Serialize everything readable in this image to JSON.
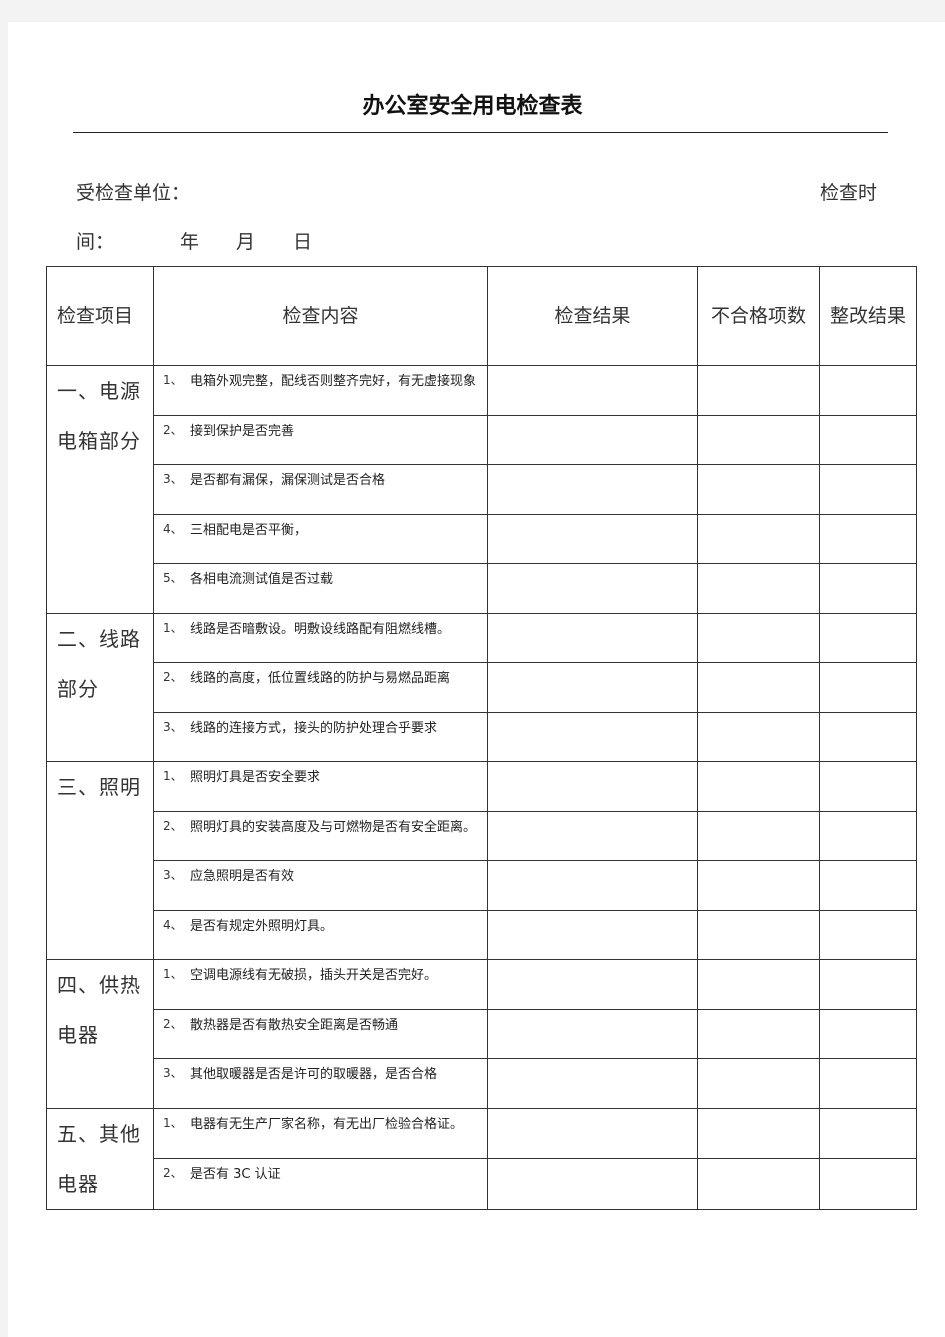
{
  "document": {
    "title": "办公室安全用电检查表",
    "unit_label": "受检查单位：",
    "time_label_part1": "检查时",
    "time_label_part2": "间：",
    "date_year": "年",
    "date_month": "月",
    "date_day": "日"
  },
  "table": {
    "headers": {
      "item": "检查项目",
      "content": "检查内容",
      "result": "检查结果",
      "fail_count": "不合格项数",
      "rectify": "整改结果"
    },
    "sections": [
      {
        "category": "一、电源电箱部分",
        "items": [
          {
            "num": "1、",
            "text": "电箱外观完整，配线否则整齐完好，有无虚接现象"
          },
          {
            "num": "2、",
            "text": "接到保护是否完善"
          },
          {
            "num": "3、",
            "text": "是否都有漏保，漏保测试是否合格"
          },
          {
            "num": "4、",
            "text": "三相配电是否平衡，"
          },
          {
            "num": "5、",
            "text": "各相电流测试值是否过载"
          }
        ]
      },
      {
        "category": "二、线路部分",
        "items": [
          {
            "num": "1、",
            "text": "线路是否暗敷设。明敷设线路配有阻燃线槽。"
          },
          {
            "num": "2、",
            "text": "线路的高度，低位置线路的防护与易燃品距离"
          },
          {
            "num": "3、",
            "text": "线路的连接方式，接头的防护处理合乎要求"
          }
        ]
      },
      {
        "category": "三、照明",
        "items": [
          {
            "num": "1、",
            "text": "照明灯具是否安全要求"
          },
          {
            "num": "2、",
            "text": "照明灯具的安装高度及与可燃物是否有安全距离。"
          },
          {
            "num": "3、",
            "text": "应急照明是否有效"
          },
          {
            "num": "4、",
            "text": "是否有规定外照明灯具。"
          }
        ]
      },
      {
        "category": "四、供热电器",
        "items": [
          {
            "num": "1、",
            "text": "空调电源线有无破损，插头开关是否完好。"
          },
          {
            "num": "2、",
            "text": "散热器是否有散热安全距离是否畅通"
          },
          {
            "num": "3、",
            "text": "其他取暖器是否是许可的取暖器，是否合格"
          }
        ]
      },
      {
        "category": "五、其他电器",
        "items": [
          {
            "num": "1、",
            "text": "电器有无生产厂家名称，有无出厂检验合格证。"
          },
          {
            "num": "2、",
            "text": "是否有 3C 认证"
          }
        ]
      }
    ]
  }
}
